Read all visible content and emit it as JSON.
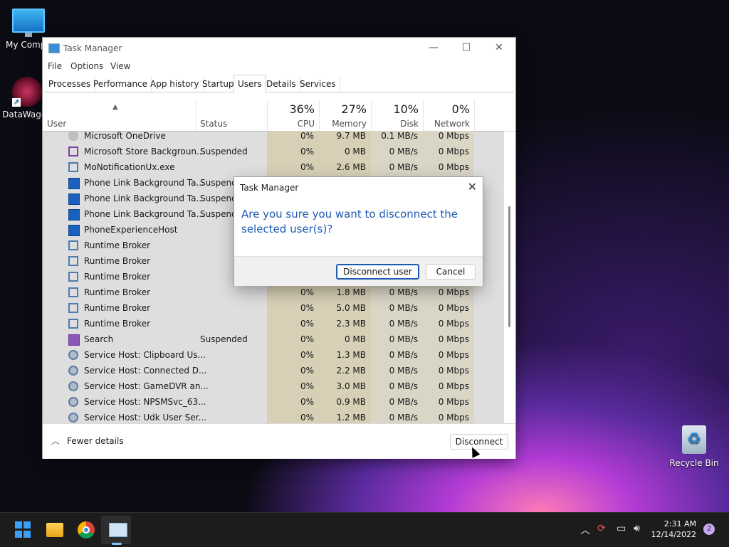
{
  "desktop": {
    "icons": [
      {
        "label": "My Compu"
      },
      {
        "label": "DataWagon"
      },
      {
        "label": "Recycle Bin"
      }
    ]
  },
  "window": {
    "title": "Task Manager",
    "menu": [
      "File",
      "Options",
      "View"
    ],
    "tabs": [
      "Processes",
      "Performance",
      "App history",
      "Startup",
      "Users",
      "Details",
      "Services"
    ],
    "active_tab": "Users",
    "columns": {
      "user": "User",
      "status": "Status",
      "cpu": {
        "pct": "36%",
        "label": "CPU"
      },
      "memory": {
        "pct": "27%",
        "label": "Memory"
      },
      "disk": {
        "pct": "10%",
        "label": "Disk"
      },
      "network": {
        "pct": "0%",
        "label": "Network"
      }
    },
    "rows": [
      {
        "name": "Microsoft OneDrive",
        "status": "",
        "cpu": "0%",
        "mem": "9.7 MB",
        "disk": "0.1 MB/s",
        "net": "0 Mbps",
        "icon": "onedrive-icon"
      },
      {
        "name": "Microsoft Store Backgroun...",
        "status": "Suspended",
        "cpu": "0%",
        "mem": "0 MB",
        "disk": "0 MB/s",
        "net": "0 Mbps",
        "icon": "store-icon"
      },
      {
        "name": "MoNotificationUx.exe",
        "status": "",
        "cpu": "0%",
        "mem": "2.6 MB",
        "disk": "0 MB/s",
        "net": "0 Mbps",
        "icon": "app-window-icon"
      },
      {
        "name": "Phone Link Background Ta...",
        "status": "Suspende",
        "cpu": "",
        "mem": "",
        "disk": "",
        "net": "",
        "icon": "phone-link-icon"
      },
      {
        "name": "Phone Link Background Ta...",
        "status": "Suspende",
        "cpu": "",
        "mem": "",
        "disk": "",
        "net": "",
        "icon": "phone-link-icon"
      },
      {
        "name": "Phone Link Background Ta...",
        "status": "Suspende",
        "cpu": "",
        "mem": "",
        "disk": "",
        "net": "",
        "icon": "phone-link-icon"
      },
      {
        "name": "PhoneExperienceHost",
        "status": "",
        "cpu": "",
        "mem": "",
        "disk": "",
        "net": "",
        "icon": "phone-link-icon"
      },
      {
        "name": "Runtime Broker",
        "status": "",
        "cpu": "",
        "mem": "",
        "disk": "",
        "net": "",
        "icon": "app-window-icon"
      },
      {
        "name": "Runtime Broker",
        "status": "",
        "cpu": "",
        "mem": "",
        "disk": "",
        "net": "",
        "icon": "app-window-icon"
      },
      {
        "name": "Runtime Broker",
        "status": "",
        "cpu": "",
        "mem": "",
        "disk": "",
        "net": "",
        "icon": "app-window-icon"
      },
      {
        "name": "Runtime Broker",
        "status": "",
        "cpu": "0%",
        "mem": "1.8 MB",
        "disk": "0 MB/s",
        "net": "0 Mbps",
        "icon": "app-window-icon"
      },
      {
        "name": "Runtime Broker",
        "status": "",
        "cpu": "0%",
        "mem": "5.0 MB",
        "disk": "0 MB/s",
        "net": "0 Mbps",
        "icon": "app-window-icon"
      },
      {
        "name": "Runtime Broker",
        "status": "",
        "cpu": "0%",
        "mem": "2.3 MB",
        "disk": "0 MB/s",
        "net": "0 Mbps",
        "icon": "app-window-icon"
      },
      {
        "name": "Search",
        "status": "Suspended",
        "cpu": "0%",
        "mem": "0 MB",
        "disk": "0 MB/s",
        "net": "0 Mbps",
        "icon": "search-app-icon"
      },
      {
        "name": "Service Host: Clipboard Us...",
        "status": "",
        "cpu": "0%",
        "mem": "1.3 MB",
        "disk": "0 MB/s",
        "net": "0 Mbps",
        "icon": "gear-icon"
      },
      {
        "name": "Service Host: Connected D...",
        "status": "",
        "cpu": "0%",
        "mem": "2.2 MB",
        "disk": "0 MB/s",
        "net": "0 Mbps",
        "icon": "gear-icon"
      },
      {
        "name": "Service Host: GameDVR an...",
        "status": "",
        "cpu": "0%",
        "mem": "3.0 MB",
        "disk": "0 MB/s",
        "net": "0 Mbps",
        "icon": "gear-icon"
      },
      {
        "name": "Service Host: NPSMSvc_63...",
        "status": "",
        "cpu": "0%",
        "mem": "0.9 MB",
        "disk": "0 MB/s",
        "net": "0 Mbps",
        "icon": "gear-icon"
      },
      {
        "name": "Service Host: Udk User Ser...",
        "status": "",
        "cpu": "0%",
        "mem": "1.2 MB",
        "disk": "0 MB/s",
        "net": "0 Mbps",
        "icon": "gear-icon"
      }
    ],
    "footer": {
      "fewer_details": "Fewer details",
      "disconnect": "Disconnect"
    }
  },
  "dialog": {
    "title": "Task Manager",
    "message": "Are you sure you want to disconnect the selected user(s)?",
    "confirm": "Disconnect user",
    "cancel": "Cancel"
  },
  "taskbar": {
    "time": "2:31 AM",
    "date": "12/14/2022",
    "notifications": "2"
  }
}
